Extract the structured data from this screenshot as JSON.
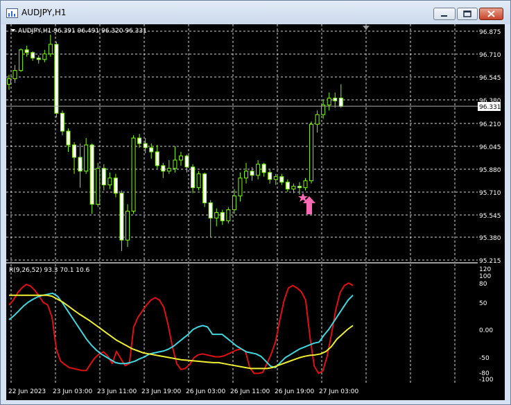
{
  "window": {
    "title": "AUDJPY,H1"
  },
  "main_chart": {
    "header": "AUDJPY,H1  96.391 96.491 96.320 96.331",
    "price_labels": [
      "96.875",
      "96.710",
      "96.545",
      "96.380",
      "96.210",
      "96.045",
      "95.880",
      "95.710",
      "95.545",
      "95.380",
      "95.215"
    ],
    "current_price": "96.331"
  },
  "indicator": {
    "header": "R(9,26,52) 93.3 70.1 10.6",
    "level_labels": [
      "120",
      "100",
      "80",
      "50",
      "0.00",
      "-50",
      "-80",
      "-100"
    ]
  },
  "time_labels": [
    "22 Jun 2023",
    "23 Jun 03:00",
    "23 Jun 11:00",
    "23 Jun 19:00",
    "26 Jun 03:00",
    "26 Jun 11:00",
    "26 Jun 19:00",
    "27 Jun 03:00"
  ],
  "colors": {
    "background": "#000000",
    "candle": "#7cfc00",
    "grid": "#ffffff",
    "red": "#e01010",
    "cyan": "#40d8e0",
    "yellow": "#f0f030",
    "arrow": "#ff69b4"
  },
  "icons": {
    "window_icon": "chart-window-icon",
    "minimize": "minimize-icon",
    "maximize": "maximize-icon",
    "close": "close-icon",
    "arrow": "buy-arrow-icon",
    "star": "star-icon",
    "header_marker": "triangle-down-icon",
    "shift_marker": "chart-shift-icon"
  },
  "chart_data": [
    {
      "type": "candlestick",
      "name": "AUDJPY H1",
      "ylim": [
        95.215,
        96.875
      ],
      "ohlc": [
        [
          96.49,
          96.56,
          96.45,
          96.53
        ],
        [
          96.53,
          96.63,
          96.5,
          96.59
        ],
        [
          96.59,
          96.75,
          96.58,
          96.74
        ],
        [
          96.74,
          96.77,
          96.69,
          96.72
        ],
        [
          96.72,
          96.73,
          96.66,
          96.68
        ],
        [
          96.68,
          96.7,
          96.64,
          96.67
        ],
        [
          96.67,
          96.74,
          96.65,
          96.71
        ],
        [
          96.71,
          96.85,
          96.69,
          96.78
        ],
        [
          96.78,
          96.8,
          96.25,
          96.28
        ],
        [
          96.28,
          96.3,
          96.12,
          96.15
        ],
        [
          96.15,
          96.17,
          96.0,
          96.05
        ],
        [
          96.05,
          96.07,
          95.84,
          95.96
        ],
        [
          95.96,
          96.06,
          95.74,
          95.86
        ],
        [
          95.86,
          96.1,
          95.84,
          96.05
        ],
        [
          96.05,
          96.06,
          95.55,
          95.62
        ],
        [
          95.62,
          95.92,
          95.6,
          95.88
        ],
        [
          95.88,
          95.91,
          95.72,
          95.76
        ],
        [
          95.76,
          95.85,
          95.73,
          95.81
        ],
        [
          95.81,
          95.84,
          95.67,
          95.7
        ],
        [
          95.7,
          95.72,
          95.28,
          95.36
        ],
        [
          95.36,
          95.62,
          95.31,
          95.57
        ],
        [
          95.57,
          96.12,
          95.55,
          96.1
        ],
        [
          96.1,
          96.13,
          96.03,
          96.06
        ],
        [
          96.06,
          96.1,
          95.99,
          96.03
        ],
        [
          96.03,
          96.06,
          95.95,
          96.0
        ],
        [
          96.0,
          96.05,
          95.88,
          95.9
        ],
        [
          95.9,
          95.92,
          95.81,
          95.86
        ],
        [
          95.86,
          95.94,
          95.84,
          95.88
        ],
        [
          95.88,
          96.04,
          95.85,
          95.94
        ],
        [
          95.94,
          96.0,
          95.9,
          95.97
        ],
        [
          95.97,
          95.98,
          95.85,
          95.89
        ],
        [
          95.89,
          95.91,
          95.7,
          95.74
        ],
        [
          95.74,
          95.86,
          95.72,
          95.84
        ],
        [
          95.84,
          95.85,
          95.6,
          95.63
        ],
        [
          95.63,
          95.65,
          95.38,
          95.52
        ],
        [
          95.52,
          95.59,
          95.46,
          95.56
        ],
        [
          95.56,
          95.58,
          95.47,
          95.5
        ],
        [
          95.5,
          95.6,
          95.48,
          95.58
        ],
        [
          95.58,
          95.73,
          95.55,
          95.68
        ],
        [
          95.68,
          95.85,
          95.64,
          95.81
        ],
        [
          95.81,
          95.92,
          95.77,
          95.86
        ],
        [
          95.86,
          95.89,
          95.79,
          95.83
        ],
        [
          95.83,
          95.94,
          95.8,
          95.91
        ],
        [
          95.91,
          95.92,
          95.82,
          95.85
        ],
        [
          95.85,
          95.87,
          95.77,
          95.8
        ],
        [
          95.8,
          95.84,
          95.76,
          95.82
        ],
        [
          95.82,
          95.84,
          95.76,
          95.78
        ],
        [
          95.78,
          95.8,
          95.71,
          95.73
        ],
        [
          95.73,
          95.77,
          95.7,
          95.75
        ],
        [
          95.75,
          95.78,
          95.69,
          95.74
        ],
        [
          95.74,
          95.81,
          95.72,
          95.79
        ],
        [
          95.79,
          96.22,
          95.77,
          96.2
        ],
        [
          96.2,
          96.3,
          96.14,
          96.27
        ],
        [
          96.27,
          96.38,
          96.24,
          96.34
        ],
        [
          96.34,
          96.43,
          96.3,
          96.39
        ],
        [
          96.39,
          96.43,
          96.32,
          96.37
        ],
        [
          96.39,
          96.49,
          96.32,
          96.33
        ]
      ]
    },
    {
      "type": "line",
      "name": "R(9,26,52)",
      "ylim": [
        -105,
        125
      ],
      "series": [
        {
          "name": "red",
          "values": [
            50,
            60,
            75,
            85,
            92,
            89,
            80,
            68,
            55,
            50,
            25,
            -40,
            -65,
            -72,
            -78,
            -80,
            -82,
            -84,
            -84,
            -70,
            -58,
            -50,
            -46,
            -55,
            -70,
            -45,
            -60,
            -74,
            -70,
            5,
            25,
            38,
            50,
            60,
            65,
            60,
            45,
            10,
            -35,
            -70,
            -82,
            -80,
            -72,
            -58,
            -52,
            -50,
            -52,
            -54,
            -56,
            -56,
            -54,
            -50,
            -46,
            -42,
            -40,
            -45,
            -78,
            -90,
            -90,
            -88,
            -70,
            -50,
            -25,
            20,
            60,
            85,
            90,
            85,
            77,
            60,
            -15,
            -75,
            -90,
            -85,
            -55,
            -10,
            40,
            75,
            90,
            95,
            90
          ]
        },
        {
          "name": "cyan",
          "values": [
            20,
            28,
            38,
            48,
            56,
            62,
            67,
            70,
            72,
            74,
            68,
            55,
            40,
            25,
            10,
            -5,
            -20,
            -32,
            -42,
            -50,
            -56,
            -62,
            -68,
            -70,
            -70,
            -68,
            -65,
            -60,
            -56,
            -50,
            -48,
            -46,
            -44,
            -40,
            -34,
            -26,
            -18,
            -10,
            0,
            5,
            8,
            5,
            -10,
            -10,
            -10,
            -18,
            -26,
            -34,
            -40,
            -46,
            -48,
            -50,
            -55,
            -65,
            -75,
            -78,
            -68,
            -58,
            -52,
            -46,
            -40,
            -36,
            -32,
            -28,
            -26,
            -12,
            0,
            15,
            30,
            45,
            60,
            70
          ]
        },
        {
          "name": "yellow",
          "values": [
            70,
            70,
            70,
            70,
            70,
            70,
            70,
            70,
            68,
            62,
            56,
            48,
            40,
            32,
            25,
            18,
            10,
            2,
            -6,
            -14,
            -22,
            -28,
            -34,
            -40,
            -44,
            -48,
            -50,
            -52,
            -54,
            -56,
            -58,
            -60,
            -62,
            -63,
            -64,
            -65,
            -66,
            -67,
            -68,
            -68,
            -70,
            -72,
            -74,
            -76,
            -78,
            -80,
            -80,
            -80,
            -80,
            -78,
            -74,
            -70,
            -66,
            -62,
            -58,
            -55,
            -53,
            -52,
            -50,
            -45,
            -35,
            -20,
            -10,
            0,
            8
          ]
        }
      ]
    }
  ]
}
